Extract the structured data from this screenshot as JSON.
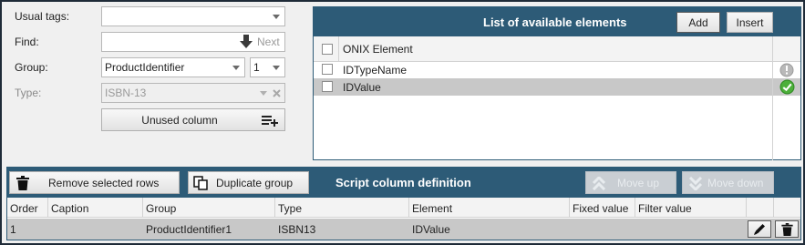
{
  "form": {
    "usual_tags_label": "Usual tags:",
    "usual_tags_value": "",
    "find_label": "Find:",
    "find_value": "",
    "find_next_label": "Next",
    "group_label": "Group:",
    "group_value": "ProductIdentifier",
    "group_index_value": "1",
    "type_label": "Type:",
    "type_value": "ISBN-13",
    "unused_column_label": "Unused column"
  },
  "available": {
    "title": "List of available elements",
    "add_label": "Add",
    "insert_label": "Insert",
    "column_header": "ONIX Element",
    "rows": [
      {
        "name": "IDTypeName",
        "status": "grey-info-icon"
      },
      {
        "name": "IDValue",
        "status": "green-check-icon"
      }
    ]
  },
  "script": {
    "remove_label": "Remove selected rows",
    "duplicate_label": "Duplicate group",
    "title": "Script column definition",
    "move_up_label": "Move up",
    "move_down_label": "Move down",
    "columns": [
      "Order",
      "Caption",
      "Group",
      "Type",
      "Element",
      "Fixed value",
      "Filter value"
    ],
    "rows": [
      {
        "order": "1",
        "caption": "",
        "group": "ProductIdentifier1",
        "type": "ISBN13",
        "element": "IDValue",
        "fixed": "",
        "filter": ""
      }
    ]
  },
  "colors": {
    "header_blue": "#2d5b77",
    "selected_row": "#c8c8c8",
    "green_check": "#4caf3a"
  }
}
